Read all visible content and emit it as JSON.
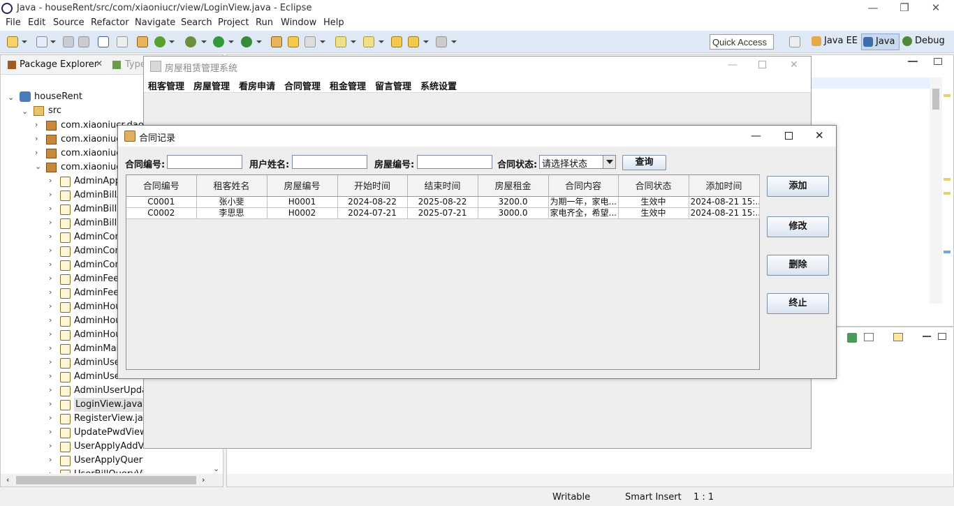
{
  "eclipse": {
    "window_title": "Java - houseRent/src/com/xiaoniucr/view/LoginView.java - Eclipse",
    "menu": [
      "File",
      "Edit",
      "Source",
      "Refactor",
      "Navigate",
      "Search",
      "Project",
      "Run",
      "Window",
      "Help"
    ],
    "quick_access": "Quick Access",
    "perspectives": [
      "Java EE",
      "Java",
      "Debug"
    ],
    "status": {
      "writable": "Writable",
      "insert_mode": "Smart Insert",
      "position": "1 : 1"
    }
  },
  "package_explorer": {
    "tab_label": "Package Explorer",
    "tab2_label": "Type",
    "project": "houseRent",
    "src": "src",
    "packages": [
      "com.xiaoniucr.dao",
      "com.xiaoniucr.",
      "com.xiaoniucr.",
      "com.xiaoniucr."
    ],
    "files": [
      "AdminApp",
      "AdminBillA",
      "AdminBillM",
      "AdminBillU",
      "AdminCont",
      "AdminCont",
      "AdminCont",
      "AdminFeed",
      "AdminFeed",
      "AdminHous",
      "AdminHous",
      "AdminHous",
      "AdminMain",
      "AdminUser",
      "AdminUser",
      "AdminUserUpdat",
      "LoginView.java",
      "RegisterView.java",
      "UpdatePwdView.j",
      "UserApplyAddView.java",
      "UserApplyQueryView.java",
      "UserBillQueryView.java"
    ]
  },
  "main_frame": {
    "title": "房屋租赁管理系统",
    "menu": [
      "租客管理",
      "房屋管理",
      "看房申请",
      "合同管理",
      "租金管理",
      "留言管理",
      "系统设置"
    ]
  },
  "dialog": {
    "title": "合同记录",
    "search": {
      "contract_no_label": "合同编号:",
      "contract_no_value": "",
      "user_name_label": "用户姓名:",
      "user_name_value": "",
      "house_no_label": "房屋编号:",
      "house_no_value": "",
      "status_label": "合同状态:",
      "status_selected": "请选择状态",
      "query_button": "查询"
    },
    "buttons": {
      "add": "添加",
      "edit": "修改",
      "delete": "删除",
      "terminate": "终止"
    },
    "table": {
      "columns": [
        "合同编号",
        "租客姓名",
        "房屋编号",
        "开始时间",
        "结束时间",
        "房屋租金",
        "合同内容",
        "合同状态",
        "添加时间"
      ],
      "rows": [
        [
          "C0001",
          "张小斐",
          "H0001",
          "2024-08-22",
          "2025-08-22",
          "3200.0",
          "为期一年，家电...",
          "生效中",
          "2024-08-21 15:..."
        ],
        [
          "C0002",
          "李思思",
          "H0002",
          "2024-07-21",
          "2025-07-21",
          "3000.0",
          "家电齐全，希望...",
          "生效中",
          "2024-08-21 15:..."
        ]
      ]
    }
  }
}
